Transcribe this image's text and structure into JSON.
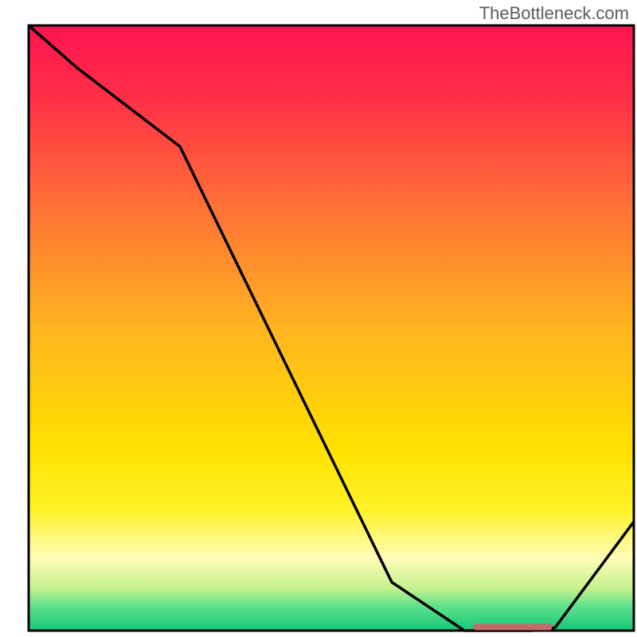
{
  "watermark": "TheBottleneck.com",
  "chart_data": {
    "type": "line",
    "title": "",
    "xlabel": "",
    "ylabel": "",
    "xlim": [
      0,
      100
    ],
    "ylim": [
      0,
      100
    ],
    "series": [
      {
        "name": "bottleneck-curve",
        "x": [
          0,
          8,
          25,
          60,
          72,
          78,
          83,
          87,
          100
        ],
        "values": [
          100,
          93,
          80,
          8,
          0,
          0,
          0,
          0.5,
          18
        ]
      },
      {
        "name": "optimal-marker",
        "x": [
          73.5,
          86.5
        ],
        "values": [
          0.6,
          0.6
        ]
      }
    ],
    "gradient_stops": [
      {
        "offset": 0.0,
        "color": "#ff1450"
      },
      {
        "offset": 0.12,
        "color": "#ff2f48"
      },
      {
        "offset": 0.3,
        "color": "#ff7136"
      },
      {
        "offset": 0.5,
        "color": "#ffb420"
      },
      {
        "offset": 0.7,
        "color": "#ffe100"
      },
      {
        "offset": 0.8,
        "color": "#fff228"
      },
      {
        "offset": 0.88,
        "color": "#fffcb8"
      },
      {
        "offset": 0.93,
        "color": "#c6f28e"
      },
      {
        "offset": 0.96,
        "color": "#5fe08c"
      },
      {
        "offset": 1.0,
        "color": "#14c878"
      }
    ],
    "frame_color": "#000000",
    "curve_color": "#000000",
    "marker_color": "#c56a6a"
  },
  "plot": {
    "inner_x": 36,
    "inner_y": 32,
    "inner_w": 760,
    "inner_h": 760
  }
}
